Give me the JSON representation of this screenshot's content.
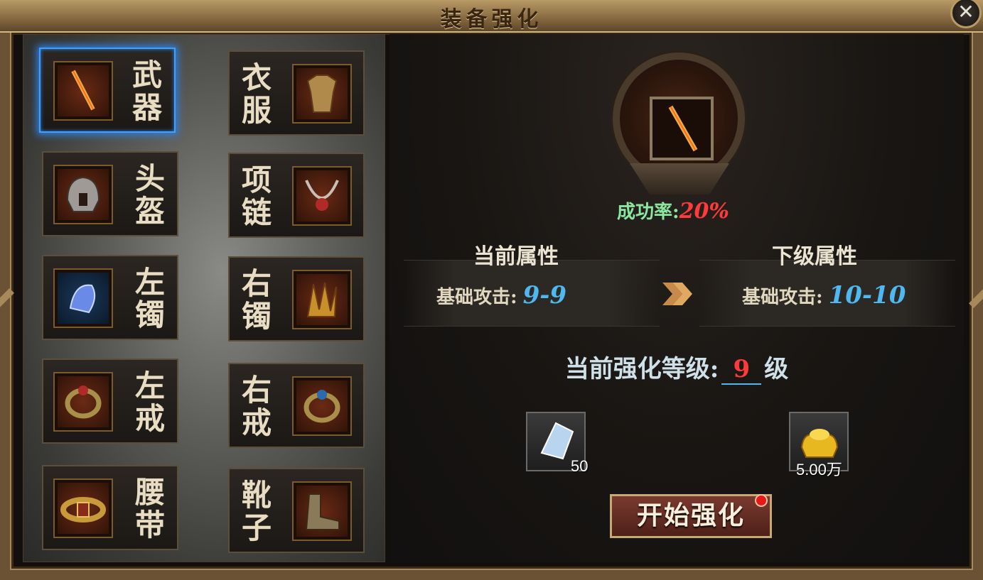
{
  "window": {
    "title": "装备强化",
    "close_symbol": "✕"
  },
  "slots": [
    {
      "label1": "武",
      "label2": "器",
      "icon": "sword-icon",
      "selected": true
    },
    {
      "label1": "衣",
      "label2": "服",
      "icon": "armor-icon"
    },
    {
      "label1": "头",
      "label2": "盔",
      "icon": "helmet-icon"
    },
    {
      "label1": "项",
      "label2": "链",
      "icon": "necklace-icon"
    },
    {
      "label1": "左",
      "label2": "镯",
      "icon": "bracelet-icon"
    },
    {
      "label1": "右",
      "label2": "镯",
      "icon": "bracelet-icon"
    },
    {
      "label1": "左",
      "label2": "戒",
      "icon": "ring-icon"
    },
    {
      "label1": "右",
      "label2": "戒",
      "icon": "ring-icon"
    },
    {
      "label1": "腰",
      "label2": "带",
      "icon": "belt-icon"
    },
    {
      "label1": "靴",
      "label2": "子",
      "icon": "boots-icon"
    }
  ],
  "enhance": {
    "success_label": "成功率:",
    "success_rate": "20%",
    "current_title": "当前属性",
    "next_title": "下级属性",
    "current_stat_label": "基础攻击:",
    "current_stat_value": "9-9",
    "next_stat_label": "基础攻击:",
    "next_stat_value": "10-10",
    "level_label": "当前强化等级:",
    "level_value": "9",
    "level_unit": "级",
    "materials": [
      {
        "icon": "crystal-icon",
        "count": "50"
      },
      {
        "icon": "gold-ingot-icon",
        "count": "5.00万"
      }
    ],
    "start_button": "开始强化"
  },
  "colors": {
    "selected_border": "#3fa0ff",
    "rate_red": "#ff3a3a",
    "stat_blue": "#4fb8f0",
    "success_green": "#8be6a0"
  }
}
